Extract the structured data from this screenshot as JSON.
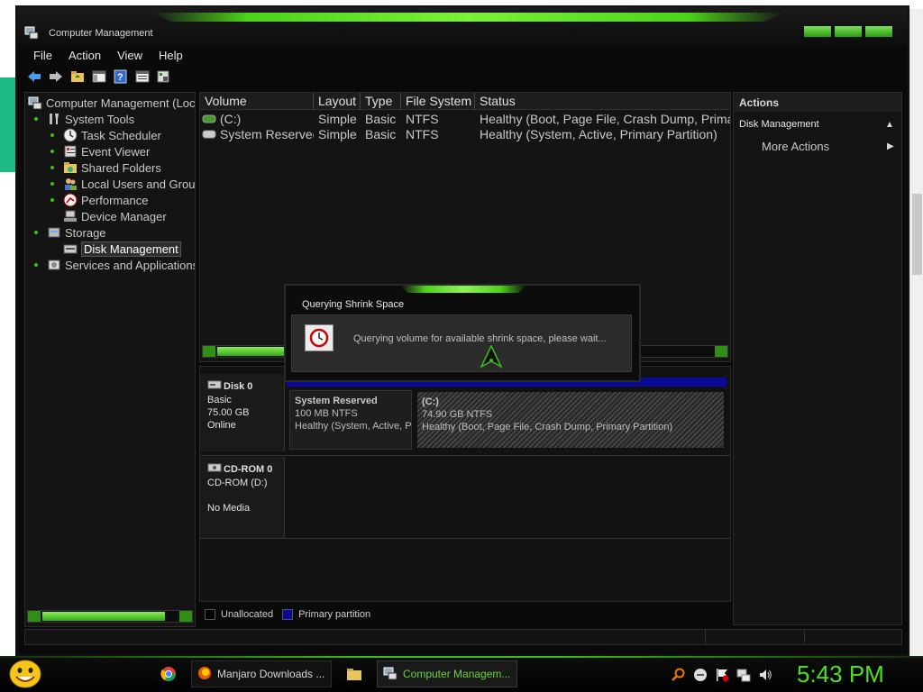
{
  "window": {
    "title": "Computer Management"
  },
  "menu": [
    "File",
    "Action",
    "View",
    "Help"
  ],
  "toolbar": [
    "back-arrow-icon",
    "forward-arrow-icon",
    "folder-up-icon",
    "show-hide-tree-icon",
    "help-icon",
    "properties-icon",
    "refresh-icon"
  ],
  "tree": {
    "root": "Computer Management (Local)",
    "items": [
      {
        "label": "System Tools",
        "icon": "tools-icon"
      },
      {
        "label": "Task Scheduler",
        "icon": "clock-icon"
      },
      {
        "label": "Event Viewer",
        "icon": "event-viewer-icon"
      },
      {
        "label": "Shared Folders",
        "icon": "shared-folder-icon"
      },
      {
        "label": "Local Users and Groups",
        "icon": "users-icon"
      },
      {
        "label": "Performance",
        "icon": "performance-icon"
      },
      {
        "label": "Device Manager",
        "icon": "device-manager-icon"
      },
      {
        "label": "Storage",
        "icon": "storage-icon"
      },
      {
        "label": "Disk Management",
        "icon": "disk-management-icon"
      },
      {
        "label": "Services and Applications",
        "icon": "services-icon"
      }
    ]
  },
  "volumes": {
    "headers": [
      "Volume",
      "Layout",
      "Type",
      "File System",
      "Status"
    ],
    "rows": [
      [
        "(C:)",
        "Simple",
        "Basic",
        "NTFS",
        "Healthy (Boot, Page File, Crash Dump, Primary Partition)"
      ],
      [
        "System Reserved",
        "Simple",
        "Basic",
        "NTFS",
        "Healthy (System, Active, Primary Partition)"
      ]
    ]
  },
  "disks": [
    {
      "name": "Disk 0",
      "type": "Basic",
      "size": "75.00 GB",
      "state": "Online",
      "partitions": [
        {
          "name": "System Reserved",
          "size": "100 MB NTFS",
          "status": "Healthy (System, Active, Primary Partition)"
        },
        {
          "name": "(C:)",
          "size": "74.90 GB NTFS",
          "status": "Healthy (Boot, Page File, Crash Dump, Primary Partition)"
        }
      ]
    },
    {
      "name": "CD-ROM 0",
      "type": "CD-ROM (D:)",
      "state": "No Media"
    }
  ],
  "legend": [
    {
      "label": "Unallocated",
      "color": "#000000"
    },
    {
      "label": "Primary partition",
      "color": "#0a0a9a"
    }
  ],
  "actions": {
    "title": "Actions",
    "section": "Disk Management",
    "more": "More Actions"
  },
  "dialog": {
    "title": "Querying Shrink Space",
    "message": "Querying volume for available shrink space, please wait..."
  },
  "taskbar": {
    "buttons": [
      {
        "label": "Manjaro Downloads ...",
        "icon": "firefox-icon"
      },
      {
        "label": "Computer Managem...",
        "icon": "computer-management-icon"
      }
    ],
    "clock": "5:43 PM"
  },
  "colors": {
    "accent": "#4dd11b",
    "window_bg": "#0a0a0a",
    "primary_partition": "#0a0a9a"
  }
}
